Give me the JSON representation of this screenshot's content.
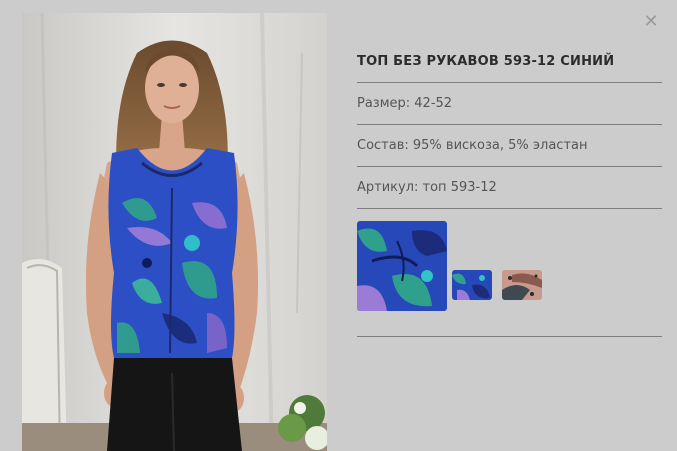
{
  "product": {
    "title": "ТОП БЕЗ РУКАВОВ 593-12 СИНИЙ",
    "size": "Размер: 42-52",
    "composition": "Состав: 95% вискоза, 5% эластан",
    "article": "Артикул: топ 593-12"
  },
  "close_icon": "close-icon",
  "swatches": [
    {
      "name": "swatch-blue-large",
      "pattern": "blue-leaf"
    },
    {
      "name": "swatch-blue-small",
      "pattern": "blue-leaf"
    },
    {
      "name": "swatch-pink-small",
      "pattern": "pink-animal"
    }
  ],
  "colors": {
    "background": "#cccccc",
    "divider": "#7d7d7d",
    "title": "#2c2c2c",
    "text": "#555555",
    "top_blue": "#2d4fc6",
    "leaf_green": "#2fa08c",
    "purple": "#9a7bd6"
  }
}
